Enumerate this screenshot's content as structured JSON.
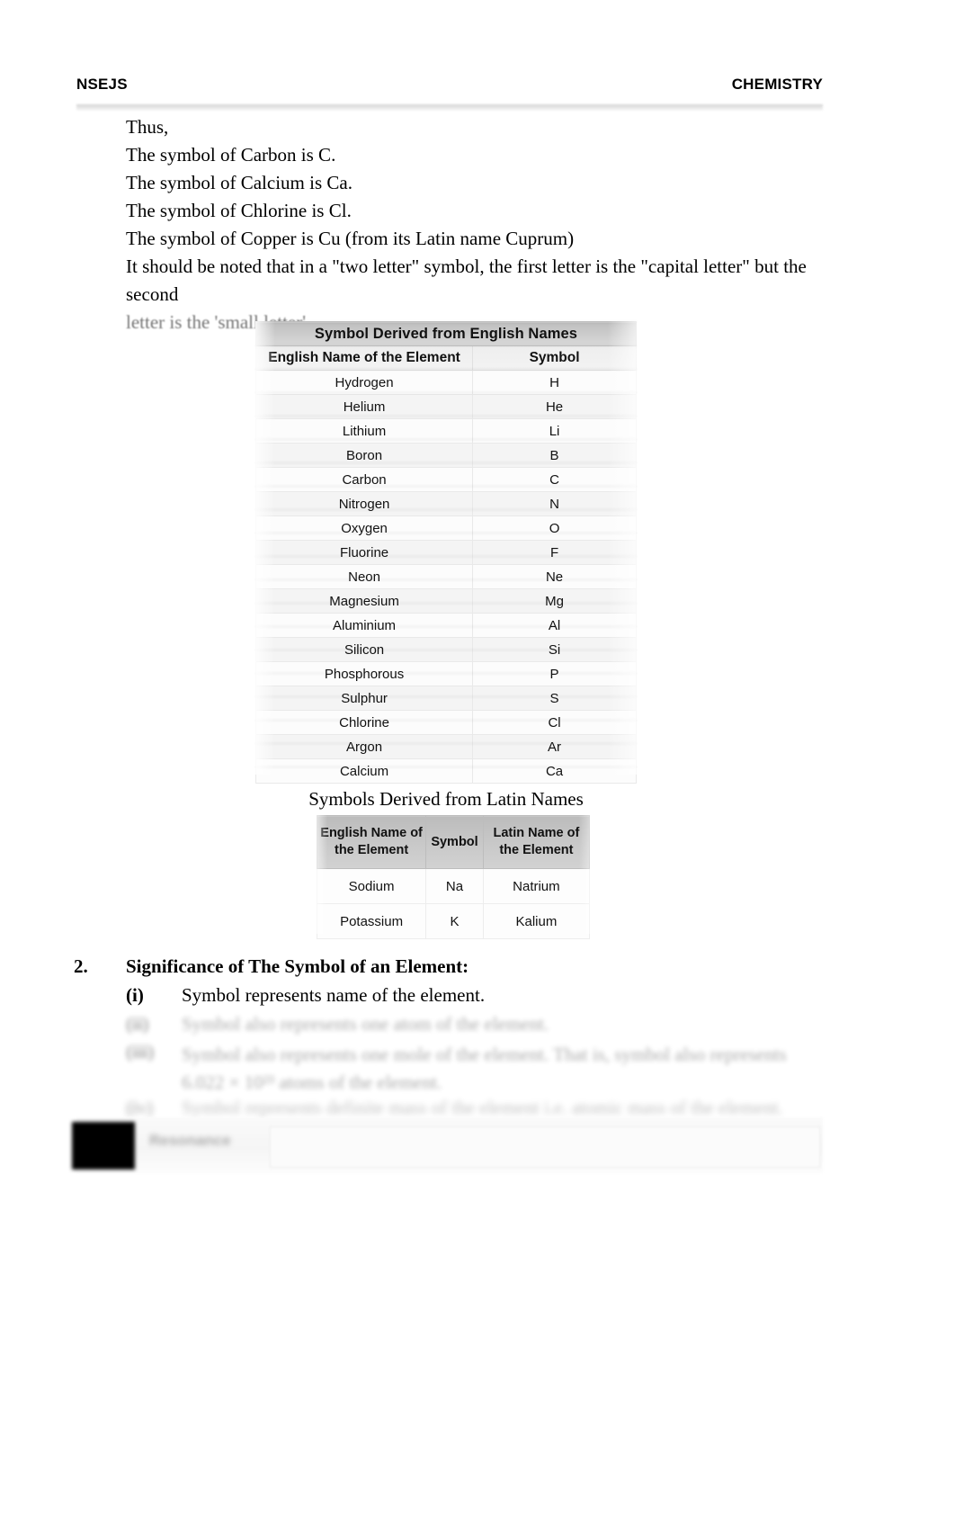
{
  "header": {
    "left": "NSEJS",
    "right": "CHEMISTRY"
  },
  "body": {
    "lines": [
      "Thus,",
      "The symbol of Carbon is C.",
      "The symbol of Calcium is Ca.",
      "The symbol of Chlorine is Cl.",
      "The symbol of Copper is Cu (from its Latin name Cuprum)"
    ],
    "note_line1": "It should be noted that in a \"two letter\" symbol, the first letter is the \"capital letter\" but the second",
    "note_line2": "letter is the 'small letter'."
  },
  "table_english": {
    "title": "Symbol Derived from English Names",
    "columns": [
      "English Name of the Element",
      "Symbol"
    ],
    "rows": [
      [
        "Hydrogen",
        "H"
      ],
      [
        "Helium",
        "He"
      ],
      [
        "Lithium",
        "Li"
      ],
      [
        "Boron",
        "B"
      ],
      [
        "Carbon",
        "C"
      ],
      [
        "Nitrogen",
        "N"
      ],
      [
        "Oxygen",
        "O"
      ],
      [
        "Fluorine",
        "F"
      ],
      [
        "Neon",
        "Ne"
      ],
      [
        "Magnesium",
        "Mg"
      ],
      [
        "Aluminium",
        "Al"
      ],
      [
        "Silicon",
        "Si"
      ],
      [
        "Phosphorous",
        "P"
      ],
      [
        "Sulphur",
        "S"
      ],
      [
        "Chlorine",
        "Cl"
      ],
      [
        "Argon",
        "Ar"
      ],
      [
        "Calcium",
        "Ca"
      ]
    ]
  },
  "table_latin": {
    "caption": "Symbols Derived from Latin Names",
    "columns": [
      "English Name of the Element",
      "Symbol",
      "Latin Name of the Element"
    ],
    "rows": [
      [
        "Sodium",
        "Na",
        "Natrium"
      ],
      [
        "Potassium",
        "K",
        "Kalium"
      ]
    ]
  },
  "section": {
    "number": "2.",
    "heading": "Significance of The Symbol of an Element:",
    "items": [
      {
        "marker": "(i)",
        "text": "Symbol represents name of the element."
      },
      {
        "marker": "(ii)",
        "text": "Symbol also represents one atom of the element."
      },
      {
        "marker": "(iii)",
        "text": "Symbol also represents one mole of the element. That is, symbol also represents 6.022 × 10²³ atoms of the element."
      },
      {
        "marker": "(iv)",
        "text": "Symbol represents definite mass of the element i.e. atomic mass of the element."
      }
    ]
  },
  "footer": {
    "brand": "Resonance"
  }
}
